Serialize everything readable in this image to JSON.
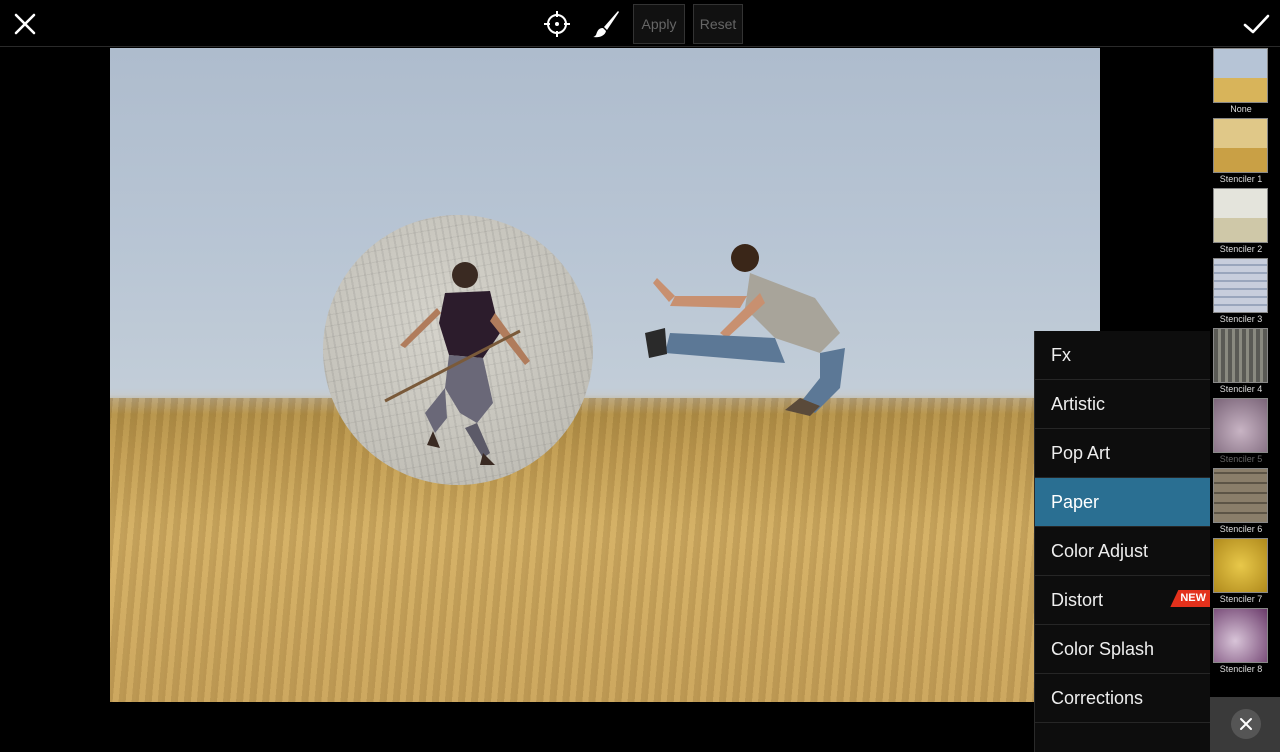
{
  "toolbar": {
    "apply_label": "Apply",
    "reset_label": "Reset",
    "close_icon": "close-icon",
    "confirm_icon": "checkmark-icon",
    "target_icon": "crosshair-icon",
    "brush_icon": "brush-icon"
  },
  "menu": {
    "items": [
      {
        "label": "Fx"
      },
      {
        "label": "Artistic"
      },
      {
        "label": "Pop Art"
      },
      {
        "label": "Paper",
        "active": true
      },
      {
        "label": "Color Adjust"
      },
      {
        "label": "Distort",
        "badge": "NEW"
      },
      {
        "label": "Color Splash"
      },
      {
        "label": "Corrections"
      }
    ],
    "active_color": "#2a6f92",
    "badge_color": "#e3311c"
  },
  "thumbnails": [
    {
      "label": "None"
    },
    {
      "label": "Stenciler 1"
    },
    {
      "label": "Stenciler 2"
    },
    {
      "label": "Stenciler 3"
    },
    {
      "label": "Stenciler 4"
    },
    {
      "label": "Stenciler 5"
    },
    {
      "label": "Stenciler 6"
    },
    {
      "label": "Stenciler 7"
    },
    {
      "label": "Stenciler 8"
    }
  ],
  "strip_close_icon": "close-icon"
}
